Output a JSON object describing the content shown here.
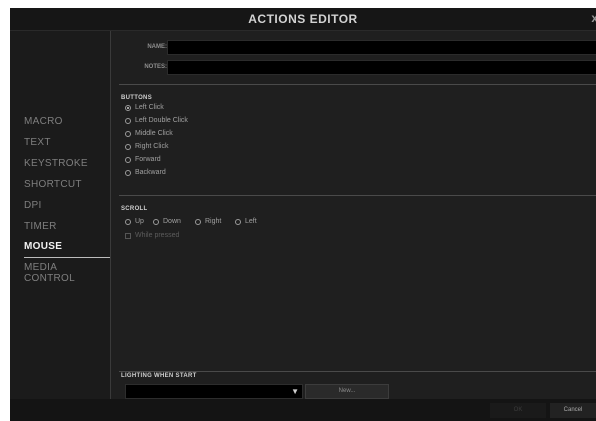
{
  "window": {
    "title": "ACTIONS EDITOR",
    "close_label": "x"
  },
  "sidebar": {
    "items": [
      {
        "label": "MACRO",
        "active": false
      },
      {
        "label": "TEXT",
        "active": false
      },
      {
        "label": "KEYSTROKE",
        "active": false
      },
      {
        "label": "SHORTCUT",
        "active": false
      },
      {
        "label": "DPI",
        "active": false
      },
      {
        "label": "TIMER",
        "active": false
      },
      {
        "label": "MOUSE",
        "active": true
      },
      {
        "label": "MEDIA CONTROL",
        "active": false
      }
    ]
  },
  "form": {
    "name_label": "NAME:",
    "name_value": "",
    "notes_label": "NOTES:",
    "notes_value": ""
  },
  "buttons_section": {
    "title": "BUTTONS",
    "options": [
      {
        "label": "Left Click",
        "checked": true
      },
      {
        "label": "Left Double Click",
        "checked": false
      },
      {
        "label": "Middle Click",
        "checked": false
      },
      {
        "label": "Right Click",
        "checked": false
      },
      {
        "label": "Forward",
        "checked": false
      },
      {
        "label": "Backward",
        "checked": false
      }
    ]
  },
  "scroll_section": {
    "title": "SCROLL",
    "options": [
      {
        "label": "Up",
        "checked": false
      },
      {
        "label": "Down",
        "checked": false
      },
      {
        "label": "Right",
        "checked": false
      },
      {
        "label": "Left",
        "checked": false
      }
    ],
    "while_pressed_label": "While pressed",
    "while_pressed_checked": false
  },
  "lighting": {
    "title": "LIGHTING WHEN START",
    "selected": "",
    "new_button": "New..."
  },
  "footer": {
    "ok_label": "OK",
    "cancel_label": "Cancel"
  }
}
